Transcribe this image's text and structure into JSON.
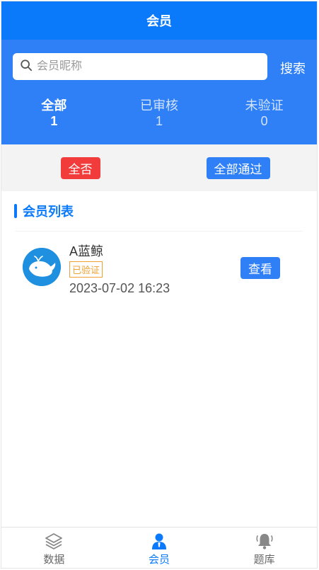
{
  "header": {
    "title": "会员"
  },
  "search": {
    "placeholder": "会员昵称",
    "button_label": "搜索"
  },
  "stats": [
    {
      "label": "全部",
      "count": "1",
      "active": true
    },
    {
      "label": "已审核",
      "count": "1",
      "active": false
    },
    {
      "label": "未验证",
      "count": "0",
      "active": false
    }
  ],
  "actions": {
    "reject_all_label": "全否",
    "approve_all_label": "全部通过"
  },
  "section": {
    "title": "会员列表"
  },
  "members": [
    {
      "name": "A蓝鲸",
      "status": "已验证",
      "time": "2023-07-02 16:23",
      "view_label": "查看"
    }
  ],
  "tabbar": [
    {
      "label": "数据",
      "icon": "layers-icon"
    },
    {
      "label": "会员",
      "icon": "user-icon",
      "active": true
    },
    {
      "label": "题库",
      "icon": "bell-icon"
    }
  ],
  "colors": {
    "primary": "#0a7afb",
    "header_bg": "#2f80f6",
    "danger": "#f23c3c",
    "badge": "#f0a030"
  }
}
